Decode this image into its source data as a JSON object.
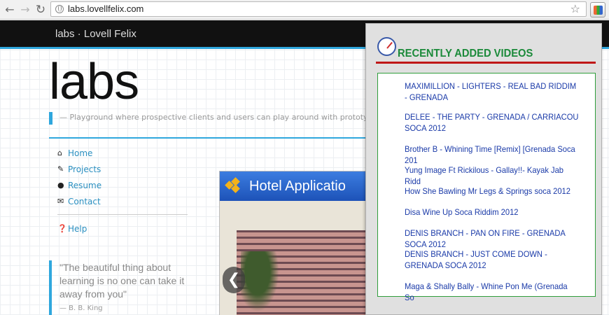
{
  "browser": {
    "url": "labs.lovellfelix.com",
    "back_glyph": "←",
    "forward_glyph": "→",
    "reload_glyph": "↻",
    "star_glyph": "☆"
  },
  "site": {
    "brand": "labs · Lovell Felix",
    "hero_title": "labs",
    "tagline": "— Playground where prospective clients and users can play around with prototypes of some of",
    "nav": [
      {
        "icon": "home-icon",
        "glyph": "⌂",
        "label": "Home"
      },
      {
        "icon": "pencil-icon",
        "glyph": "✎",
        "label": "Projects"
      },
      {
        "icon": "user-icon",
        "glyph": "●",
        "label": "Resume"
      },
      {
        "icon": "envelope-icon",
        "glyph": "✉",
        "label": "Contact"
      }
    ],
    "help": {
      "icon": "question-icon",
      "glyph": "❓",
      "label": "Help"
    },
    "quote": "\"The beautiful thing about learning is no one can take it away from you\"",
    "quote_author": "— B. B. King",
    "hotel_title": "Hotel Applicatio",
    "carousel_prev": "❮"
  },
  "popup": {
    "title": "RECENTLY ADDED VIDEOS",
    "title_color": "#1b8a3a",
    "videos": [
      "MAXIMILLION - LIGHTERS - REAL BAD RIDDIM - GRENADA",
      "DELEE - THE PARTY - GRENADA / CARRIACOU SOCA 2012",
      "Brother B - Whining Time [Remix] [Grenada Soca 201",
      "Yung Image Ft Rickilous - Gallay!!- Kayak Jab Ridd",
      "How She Bawling Mr Legs & Springs soca 2012",
      "Disa Wine Up Soca Riddim 2012",
      "DENIS BRANCH - PAN ON FIRE - GRENADA SOCA 2012",
      "DENIS BRANCH - JUST COME DOWN - GRENADA SOCA 2012",
      "Maga & Shally Bally - Whine Pon Me (Grenada So"
    ]
  },
  "colors": {
    "accent": "#2fa7dd",
    "link": "#2a8fc0",
    "popup_rule": "#c01818",
    "video_link": "#1a3aa8"
  }
}
